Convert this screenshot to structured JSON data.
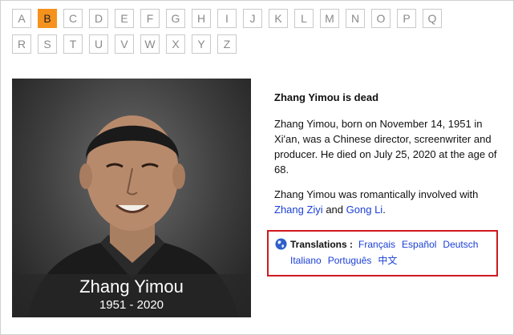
{
  "alphabet": {
    "row1": [
      "A",
      "B",
      "C",
      "D",
      "E",
      "F",
      "G",
      "H",
      "I",
      "J",
      "K",
      "L",
      "M",
      "N",
      "O",
      "P",
      "Q"
    ],
    "row2": [
      "R",
      "S",
      "T",
      "U",
      "V",
      "W",
      "X",
      "Y",
      "Z"
    ],
    "selected": "B"
  },
  "photo": {
    "name": "Zhang Yimou",
    "years": "1951 - 2020"
  },
  "article": {
    "title": "Zhang Yimou is dead",
    "bio": "Zhang Yimou, born on November 14, 1951 in Xi'an, was a Chinese director, screenwriter and producer. He died on July 25, 2020 at the age of 68.",
    "relationship_prefix": "Zhang Yimou was romantically involved with",
    "partner1": "Zhang Ziyi",
    "and": "and",
    "partner2": "Gong Li",
    "period": "."
  },
  "translations": {
    "label": "Translations :",
    "line1": [
      "Français",
      "Español",
      "Deutsch"
    ],
    "line2": [
      "Italiano",
      "Português",
      "中文"
    ]
  },
  "colors": {
    "active_letter": "#f5921e",
    "link": "#1a3fd6",
    "highlight_border": "#d0191f"
  }
}
